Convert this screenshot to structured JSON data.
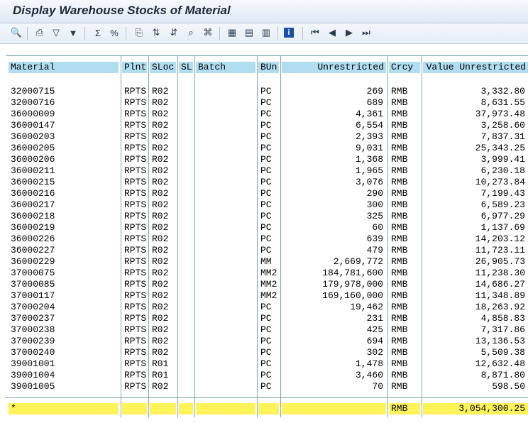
{
  "window": {
    "title": "Display Warehouse Stocks of Material"
  },
  "toolbar": {
    "icons": [
      "details-icon",
      "print-icon",
      "filter-icon",
      "set-filter-icon",
      "sum-icon",
      "subtotal-icon",
      "export-icon",
      "sort-ascending-icon",
      "sort-descending-icon",
      "find-icon",
      "find-next-icon",
      "choose-layout-icon",
      "change-layout-icon",
      "save-layout-icon",
      "info-icon",
      "first-page-icon",
      "previous-page-icon",
      "next-page-icon",
      "last-page-icon"
    ]
  },
  "table": {
    "headers": {
      "material": "Material",
      "plnt": "Plnt",
      "sloc": "SLoc",
      "sl": "SL",
      "batch": "Batch",
      "bun": "BUn",
      "unrestricted": "Unrestricted",
      "crcy": "Crcy",
      "value": "Value Unrestricted"
    },
    "rows": [
      {
        "material": "32000715",
        "plnt": "RPTS",
        "sloc": "R02",
        "bun": "PC",
        "unrestricted": "269",
        "crcy": "RMB",
        "value": "3,332.80"
      },
      {
        "material": "32000716",
        "plnt": "RPTS",
        "sloc": "R02",
        "bun": "PC",
        "unrestricted": "689",
        "crcy": "RMB",
        "value": "8,631.55"
      },
      {
        "material": "36000009",
        "plnt": "RPTS",
        "sloc": "R02",
        "bun": "PC",
        "unrestricted": "4,361",
        "crcy": "RMB",
        "value": "37,973.48"
      },
      {
        "material": "36000147",
        "plnt": "RPTS",
        "sloc": "R02",
        "bun": "PC",
        "unrestricted": "6,554",
        "crcy": "RMB",
        "value": "3,258.60"
      },
      {
        "material": "36000203",
        "plnt": "RPTS",
        "sloc": "R02",
        "bun": "PC",
        "unrestricted": "2,393",
        "crcy": "RMB",
        "value": "7,837.31"
      },
      {
        "material": "36000205",
        "plnt": "RPTS",
        "sloc": "R02",
        "bun": "PC",
        "unrestricted": "9,031",
        "crcy": "RMB",
        "value": "25,343.25"
      },
      {
        "material": "36000206",
        "plnt": "RPTS",
        "sloc": "R02",
        "bun": "PC",
        "unrestricted": "1,368",
        "crcy": "RMB",
        "value": "3,999.41"
      },
      {
        "material": "36000211",
        "plnt": "RPTS",
        "sloc": "R02",
        "bun": "PC",
        "unrestricted": "1,965",
        "crcy": "RMB",
        "value": "6,230.18"
      },
      {
        "material": "36000215",
        "plnt": "RPTS",
        "sloc": "R02",
        "bun": "PC",
        "unrestricted": "3,076",
        "crcy": "RMB",
        "value": "10,273.84"
      },
      {
        "material": "36000216",
        "plnt": "RPTS",
        "sloc": "R02",
        "bun": "PC",
        "unrestricted": "290",
        "crcy": "RMB",
        "value": "7,199.43"
      },
      {
        "material": "36000217",
        "plnt": "RPTS",
        "sloc": "R02",
        "bun": "PC",
        "unrestricted": "300",
        "crcy": "RMB",
        "value": "6,589.23"
      },
      {
        "material": "36000218",
        "plnt": "RPTS",
        "sloc": "R02",
        "bun": "PC",
        "unrestricted": "325",
        "crcy": "RMB",
        "value": "6,977.29"
      },
      {
        "material": "36000219",
        "plnt": "RPTS",
        "sloc": "R02",
        "bun": "PC",
        "unrestricted": "60",
        "crcy": "RMB",
        "value": "1,137.69"
      },
      {
        "material": "36000226",
        "plnt": "RPTS",
        "sloc": "R02",
        "bun": "PC",
        "unrestricted": "639",
        "crcy": "RMB",
        "value": "14,203.12"
      },
      {
        "material": "36000227",
        "plnt": "RPTS",
        "sloc": "R02",
        "bun": "PC",
        "unrestricted": "479",
        "crcy": "RMB",
        "value": "11,723.11"
      },
      {
        "material": "36000229",
        "plnt": "RPTS",
        "sloc": "R02",
        "bun": "MM",
        "unrestricted": "2,669,772",
        "crcy": "RMB",
        "value": "26,905.73"
      },
      {
        "material": "37000075",
        "plnt": "RPTS",
        "sloc": "R02",
        "bun": "MM2",
        "unrestricted": "184,781,600",
        "crcy": "RMB",
        "value": "11,238.30"
      },
      {
        "material": "37000085",
        "plnt": "RPTS",
        "sloc": "R02",
        "bun": "MM2",
        "unrestricted": "179,978,000",
        "crcy": "RMB",
        "value": "14,686.27"
      },
      {
        "material": "37000117",
        "plnt": "RPTS",
        "sloc": "R02",
        "bun": "MM2",
        "unrestricted": "169,160,000",
        "crcy": "RMB",
        "value": "11,348.89"
      },
      {
        "material": "37000204",
        "plnt": "RPTS",
        "sloc": "R02",
        "bun": "PC",
        "unrestricted": "19,462",
        "crcy": "RMB",
        "value": "18,263.92"
      },
      {
        "material": "37000237",
        "plnt": "RPTS",
        "sloc": "R02",
        "bun": "PC",
        "unrestricted": "231",
        "crcy": "RMB",
        "value": "4,858.83"
      },
      {
        "material": "37000238",
        "plnt": "RPTS",
        "sloc": "R02",
        "bun": "PC",
        "unrestricted": "425",
        "crcy": "RMB",
        "value": "7,317.86"
      },
      {
        "material": "37000239",
        "plnt": "RPTS",
        "sloc": "R02",
        "bun": "PC",
        "unrestricted": "694",
        "crcy": "RMB",
        "value": "13,136.53"
      },
      {
        "material": "37000240",
        "plnt": "RPTS",
        "sloc": "R02",
        "bun": "PC",
        "unrestricted": "302",
        "crcy": "RMB",
        "value": "5,509.38"
      },
      {
        "material": "39001001",
        "plnt": "RPTS",
        "sloc": "R01",
        "bun": "PC",
        "unrestricted": "1,478",
        "crcy": "RMB",
        "value": "12,632.48"
      },
      {
        "material": "39001004",
        "plnt": "RPTS",
        "sloc": "R01",
        "bun": "PC",
        "unrestricted": "3,460",
        "crcy": "RMB",
        "value": "8,871.80"
      },
      {
        "material": "39001005",
        "plnt": "RPTS",
        "sloc": "R02",
        "bun": "PC",
        "unrestricted": "70",
        "crcy": "RMB",
        "value": "598.50"
      }
    ],
    "total": {
      "marker": "*",
      "crcy": "RMB",
      "value": "3,054,300.25"
    }
  },
  "colors": {
    "header_bg": "#b0ddf0",
    "total_bg": "#fff35a",
    "grid": "#7fa4c4"
  }
}
